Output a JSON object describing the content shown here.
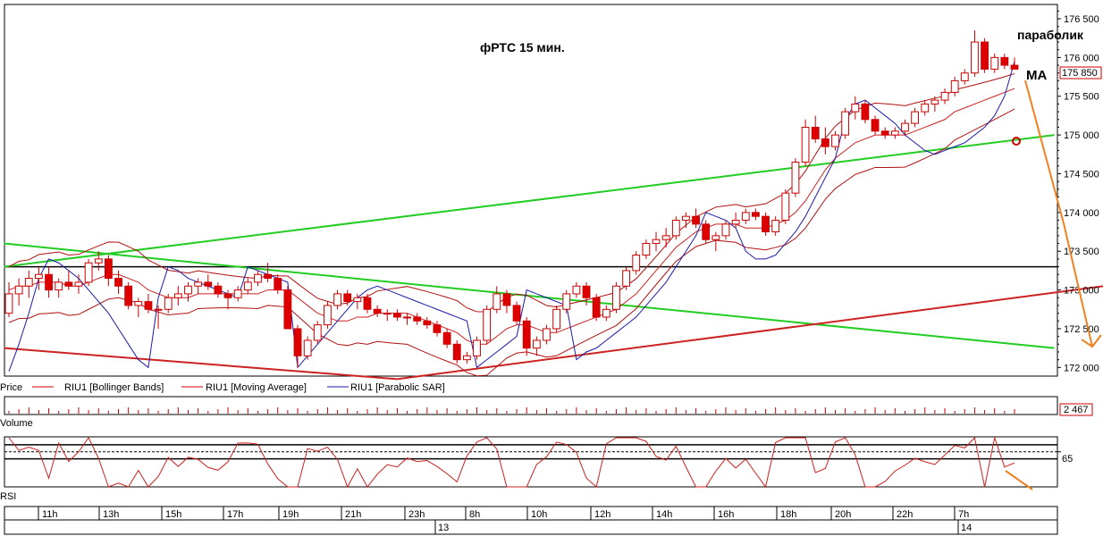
{
  "chart_data": {
    "type": "candlestick",
    "title": "фРТС  15 мин.",
    "instrument": "RIU1",
    "price_axis": {
      "ylim": [
        171900,
        176650
      ],
      "ticks": [
        172000,
        172500,
        173000,
        173500,
        174000,
        174500,
        175000,
        175500,
        176000,
        176500
      ],
      "tick_labels": [
        "172 000",
        "172 500",
        "173 000",
        "173 500",
        "174 000",
        "174 500",
        "175 000",
        "175 500",
        "176 000",
        "176 500"
      ],
      "current_value": "175 850",
      "current_price": 175850
    },
    "legend": [
      {
        "label": "Price",
        "color": "#cc0000"
      },
      {
        "label": "RIU1 [Bollinger Bands]",
        "color": "#cc0000"
      },
      {
        "label": "RIU1 [Moving Average]",
        "color": "#cc0000"
      },
      {
        "label": "RIU1 [Parabolic SAR]",
        "color": "#1a1aaa"
      }
    ],
    "volume_label": "Volume",
    "volume_value": "2 467",
    "rsi_label": "RSI",
    "rsi_tick": "65",
    "rsi_levels": [
      70,
      65,
      60
    ],
    "time_labels": [
      "11h",
      "13h",
      "15h",
      "17h",
      "19h",
      "21h",
      "23h",
      "8h",
      "10h",
      "12h",
      "14h",
      "16h",
      "18h",
      "20h",
      "22h",
      "7h"
    ],
    "day_labels": [
      "13",
      "14"
    ],
    "annotations": {
      "parabolic": "параболик",
      "ma": "МА"
    },
    "price_series": [
      [
        172700,
        173100,
        172650,
        172950
      ],
      [
        172950,
        173150,
        172800,
        173050
      ],
      [
        173050,
        173250,
        172900,
        173150
      ],
      [
        173150,
        173300,
        173000,
        173200
      ],
      [
        173200,
        173300,
        172900,
        173000
      ],
      [
        173000,
        173150,
        172900,
        173100
      ],
      [
        173100,
        173250,
        173000,
        173050
      ],
      [
        173050,
        173200,
        172950,
        173100
      ],
      [
        173100,
        173400,
        173050,
        173350
      ],
      [
        173350,
        173500,
        173250,
        173400
      ],
      [
        173400,
        173450,
        173050,
        173150
      ],
      [
        173150,
        173250,
        172950,
        173050
      ],
      [
        173050,
        173100,
        172750,
        172800
      ],
      [
        172800,
        172900,
        172650,
        172850
      ],
      [
        172850,
        172950,
        172700,
        172750
      ],
      [
        172750,
        172800,
        172500,
        172750
      ],
      [
        172750,
        172950,
        172700,
        172900
      ],
      [
        172900,
        173050,
        172800,
        172950
      ],
      [
        172950,
        173100,
        172850,
        173050
      ],
      [
        173050,
        173150,
        172950,
        173100
      ],
      [
        173100,
        173200,
        173000,
        173050
      ],
      [
        173050,
        173100,
        172900,
        172950
      ],
      [
        172950,
        173000,
        172750,
        172900
      ],
      [
        172900,
        173050,
        172850,
        173000
      ],
      [
        173000,
        173150,
        172950,
        173100
      ],
      [
        173100,
        173250,
        173050,
        173200
      ],
      [
        173200,
        173350,
        173100,
        173150
      ],
      [
        173150,
        173200,
        172950,
        173000
      ],
      [
        173000,
        173050,
        172700,
        172500
      ],
      [
        172500,
        172550,
        172000,
        172150
      ],
      [
        172150,
        172400,
        172100,
        172350
      ],
      [
        172350,
        172600,
        172300,
        172550
      ],
      [
        172550,
        172850,
        172500,
        172800
      ],
      [
        172800,
        173000,
        172750,
        172950
      ],
      [
        172950,
        173000,
        172800,
        172850
      ],
      [
        172850,
        172950,
        172750,
        172900
      ],
      [
        172900,
        172950,
        172700,
        172750
      ],
      [
        172750,
        172800,
        172650,
        172700
      ],
      [
        172700,
        172750,
        172600,
        172700
      ],
      [
        172700,
        172750,
        172600,
        172650
      ],
      [
        172650,
        172700,
        172550,
        172650
      ],
      [
        172650,
        172700,
        172550,
        172600
      ],
      [
        172600,
        172650,
        172500,
        172550
      ],
      [
        172550,
        172600,
        172400,
        172450
      ],
      [
        172450,
        172500,
        172250,
        172300
      ],
      [
        172300,
        172350,
        172050,
        172100
      ],
      [
        172100,
        172200,
        172050,
        172150
      ],
      [
        172150,
        172400,
        172100,
        172350
      ],
      [
        172350,
        172800,
        172300,
        172750
      ],
      [
        172750,
        173050,
        172700,
        172950
      ],
      [
        172950,
        173000,
        172700,
        172800
      ],
      [
        172800,
        172850,
        172550,
        172600
      ],
      [
        172600,
        172650,
        172150,
        172250
      ],
      [
        172250,
        172400,
        172150,
        172350
      ],
      [
        172350,
        172550,
        172300,
        172500
      ],
      [
        172500,
        172800,
        172450,
        172750
      ],
      [
        172750,
        173000,
        172700,
        172950
      ],
      [
        172950,
        173100,
        172900,
        173050
      ],
      [
        173050,
        173100,
        172800,
        172900
      ],
      [
        172900,
        172950,
        172600,
        172650
      ],
      [
        172650,
        172800,
        172600,
        172750
      ],
      [
        172750,
        173100,
        172700,
        173050
      ],
      [
        173050,
        173300,
        173000,
        173250
      ],
      [
        173250,
        173500,
        173200,
        173450
      ],
      [
        173450,
        173650,
        173400,
        173600
      ],
      [
        173600,
        173750,
        173500,
        173650
      ],
      [
        173650,
        173800,
        173550,
        173700
      ],
      [
        173700,
        173950,
        173650,
        173900
      ],
      [
        173900,
        174000,
        173800,
        173950
      ],
      [
        173950,
        174050,
        173800,
        173850
      ],
      [
        173850,
        173900,
        173600,
        173650
      ],
      [
        173650,
        173750,
        173500,
        173700
      ],
      [
        173700,
        173900,
        173650,
        173850
      ],
      [
        173850,
        174000,
        173800,
        173900
      ],
      [
        173900,
        174050,
        173850,
        174000
      ],
      [
        174000,
        174050,
        173900,
        173950
      ],
      [
        173950,
        174000,
        173700,
        173750
      ],
      [
        173750,
        173950,
        173700,
        173900
      ],
      [
        173900,
        174300,
        173850,
        174250
      ],
      [
        174250,
        174700,
        174200,
        174650
      ],
      [
        174650,
        175200,
        174600,
        175100
      ],
      [
        175100,
        175250,
        174900,
        174950
      ],
      [
        174950,
        175100,
        174750,
        174850
      ],
      [
        174850,
        175050,
        174800,
        175000
      ],
      [
        175000,
        175350,
        174950,
        175300
      ],
      [
        175300,
        175500,
        175200,
        175400
      ],
      [
        175400,
        175450,
        175150,
        175200
      ],
      [
        175200,
        175250,
        175000,
        175050
      ],
      [
        175050,
        175100,
        174950,
        175000
      ],
      [
        175000,
        175100,
        174950,
        175050
      ],
      [
        175050,
        175200,
        175000,
        175150
      ],
      [
        175150,
        175350,
        175100,
        175300
      ],
      [
        175300,
        175450,
        175250,
        175400
      ],
      [
        175400,
        175500,
        175300,
        175450
      ],
      [
        175450,
        175600,
        175400,
        175550
      ],
      [
        175550,
        175750,
        175500,
        175700
      ],
      [
        175700,
        175850,
        175650,
        175800
      ],
      [
        175800,
        176350,
        175750,
        176200
      ],
      [
        176200,
        176250,
        175800,
        175850
      ],
      [
        175850,
        176050,
        175800,
        176000
      ],
      [
        176000,
        176050,
        175850,
        175900
      ],
      [
        175900,
        176000,
        175850,
        175850
      ]
    ],
    "ma_series": [
      173000,
      173050,
      173050,
      173100,
      173100,
      173100,
      173050,
      173050,
      173100,
      173150,
      173200,
      173200,
      173150,
      173100,
      173000,
      172950,
      172900,
      172900,
      172900,
      172950,
      172950,
      172950,
      172950,
      172950,
      172950,
      172950,
      173000,
      173000,
      173000,
      172900,
      172800,
      172700,
      172650,
      172600,
      172600,
      172650,
      172650,
      172700,
      172700,
      172700,
      172700,
      172650,
      172600,
      172550,
      172500,
      172450,
      172350,
      172300,
      172300,
      172400,
      172500,
      172550,
      172550,
      172500,
      172450,
      172450,
      172500,
      172550,
      172600,
      172650,
      172700,
      172750,
      172850,
      172950,
      173100,
      173250,
      173400,
      173550,
      173650,
      173750,
      173800,
      173850,
      173850,
      173850,
      173800,
      173800,
      173800,
      173850,
      173900,
      174000,
      174150,
      174350,
      174550,
      174700,
      174800,
      174900,
      174950,
      175000,
      175000,
      175000,
      175000,
      175050,
      175100,
      175150,
      175200,
      175300,
      175350,
      175400,
      175450,
      175500,
      175550,
      175600
    ],
    "sar_series": [
      171950,
      172300,
      172700,
      173150,
      173400,
      173350,
      173250,
      173150,
      173000,
      172850,
      172700,
      172500,
      172300,
      172100,
      172000,
      172900,
      173300,
      173250,
      173150,
      173100,
      173050,
      173000,
      172950,
      172900,
      173300,
      173250,
      173200,
      173150,
      173100,
      172000,
      172150,
      172300,
      172450,
      172600,
      172750,
      172900,
      173000,
      173050,
      173000,
      172950,
      172900,
      172850,
      172800,
      172750,
      172700,
      172650,
      172600,
      172000,
      172100,
      172200,
      172300,
      172400,
      173000,
      172950,
      172900,
      172850,
      172800,
      172100,
      172200,
      172250,
      172350,
      172450,
      172550,
      172650,
      172800,
      172950,
      173100,
      173300,
      173500,
      173700,
      174000,
      173950,
      173900,
      173800,
      173500,
      173400,
      173400,
      173450,
      173600,
      173750,
      173950,
      174200,
      174450,
      174700,
      175200,
      175400,
      175450,
      175350,
      175250,
      175150,
      175000,
      174900,
      174800,
      174750,
      174800,
      174850,
      174900,
      175000,
      175100,
      175250,
      175500,
      175950
    ]
  }
}
